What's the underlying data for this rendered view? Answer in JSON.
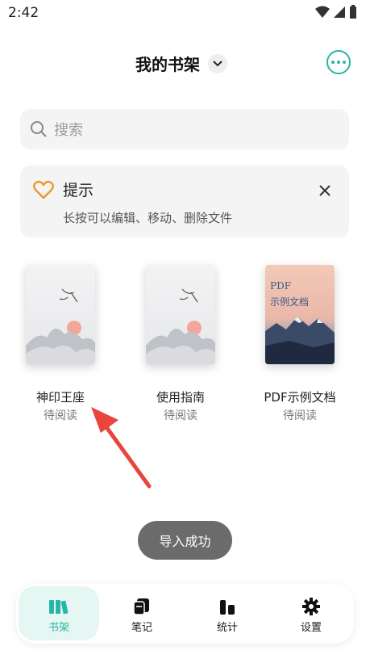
{
  "status_bar": {
    "time": "2:42"
  },
  "header": {
    "title": "我的书架"
  },
  "search": {
    "placeholder": "搜索"
  },
  "tip": {
    "title": "提示",
    "text": "长按可以编辑、移动、删除文件"
  },
  "books": [
    {
      "title": "神印王座",
      "status": "待阅读"
    },
    {
      "title": "使用指南",
      "status": "待阅读"
    },
    {
      "title": "PDF示例文档",
      "status": "待阅读",
      "cover_line1": "PDF",
      "cover_line2": "示例文档"
    }
  ],
  "toast": {
    "text": "导入成功"
  },
  "bottom_nav": [
    {
      "label": "书架",
      "icon": "bookshelf-icon",
      "active": true
    },
    {
      "label": "笔记",
      "icon": "notes-icon",
      "active": false
    },
    {
      "label": "统计",
      "icon": "stats-icon",
      "active": false
    },
    {
      "label": "设置",
      "icon": "gear-icon",
      "active": false
    }
  ],
  "colors": {
    "accent": "#27b7a4",
    "heart": "#f0962a",
    "arrow": "#e8453c"
  }
}
